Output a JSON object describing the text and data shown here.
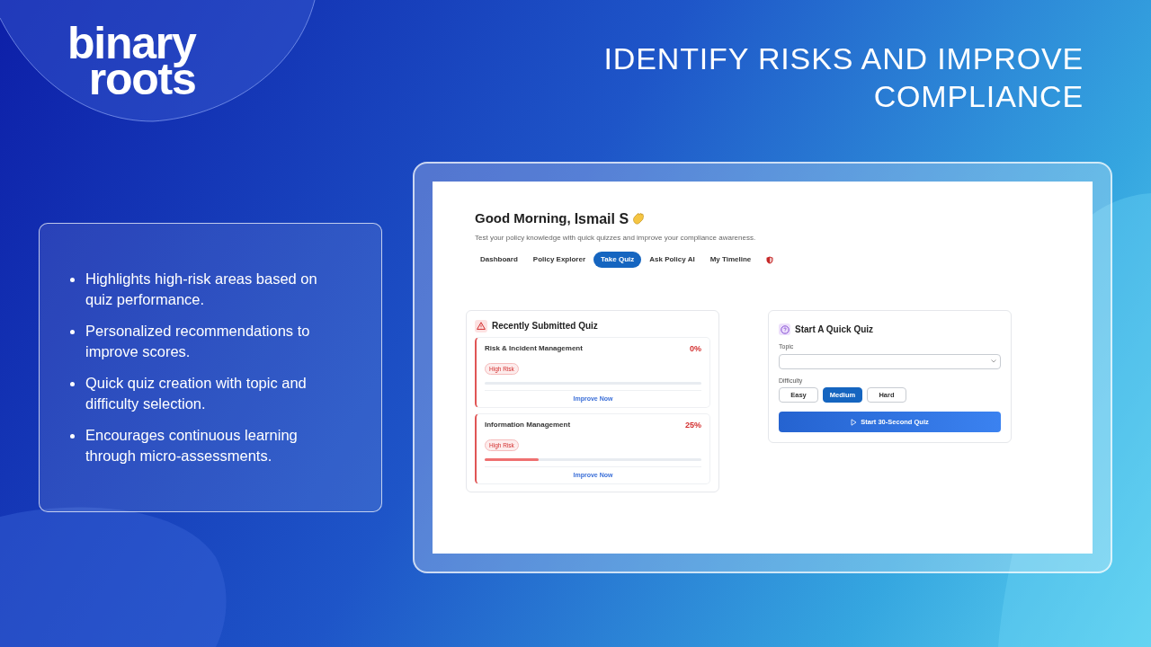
{
  "logo": {
    "lines": [
      "binary",
      "roots"
    ]
  },
  "headline": {
    "lines": [
      "IDENTIFY RISKS AND IMPROVE",
      "COMPLIANCE"
    ]
  },
  "features": [
    "Highlights high-risk areas based on quiz performance.",
    "Personalized recommendations to improve scores.",
    "Quick quiz creation with topic and difficulty selection.",
    "Encourages continuous learning through micro-assessments."
  ],
  "app": {
    "greeting": "Good Morning,",
    "user": "Ismail S",
    "subtitle": "Test your policy knowledge with quick quizzes and improve your compliance awareness.",
    "tabs": [
      {
        "kind": "text",
        "label": "Dashboard",
        "selected": false
      },
      {
        "kind": "text",
        "label": "Policy Explorer",
        "selected": false
      },
      {
        "kind": "text",
        "label": "Take Quiz",
        "selected": true
      },
      {
        "kind": "text",
        "label": "Ask Policy AI",
        "selected": false
      },
      {
        "kind": "text",
        "label": "My Timeline",
        "selected": false
      },
      {
        "kind": "icon",
        "selected": false
      }
    ],
    "recent": {
      "title": "Recently Submitted Quiz",
      "items": [
        {
          "name": "Risk & Incident Management",
          "score": "0%",
          "badge": "High Risk",
          "level": 0,
          "action": "Improve Now"
        },
        {
          "name": "Information Management",
          "score": "25%",
          "badge": "High Risk",
          "level": 0.25,
          "action": "Improve Now"
        }
      ]
    },
    "quick": {
      "title": "Start A Quick Quiz",
      "topic_label": "Topic",
      "difficulty_label": "Difficulty",
      "difficulties": [
        {
          "label": "Easy",
          "selected": false
        },
        {
          "label": "Medium",
          "selected": true
        },
        {
          "label": "Hard",
          "selected": false
        }
      ],
      "start": "Start 30-Second Quiz"
    }
  }
}
